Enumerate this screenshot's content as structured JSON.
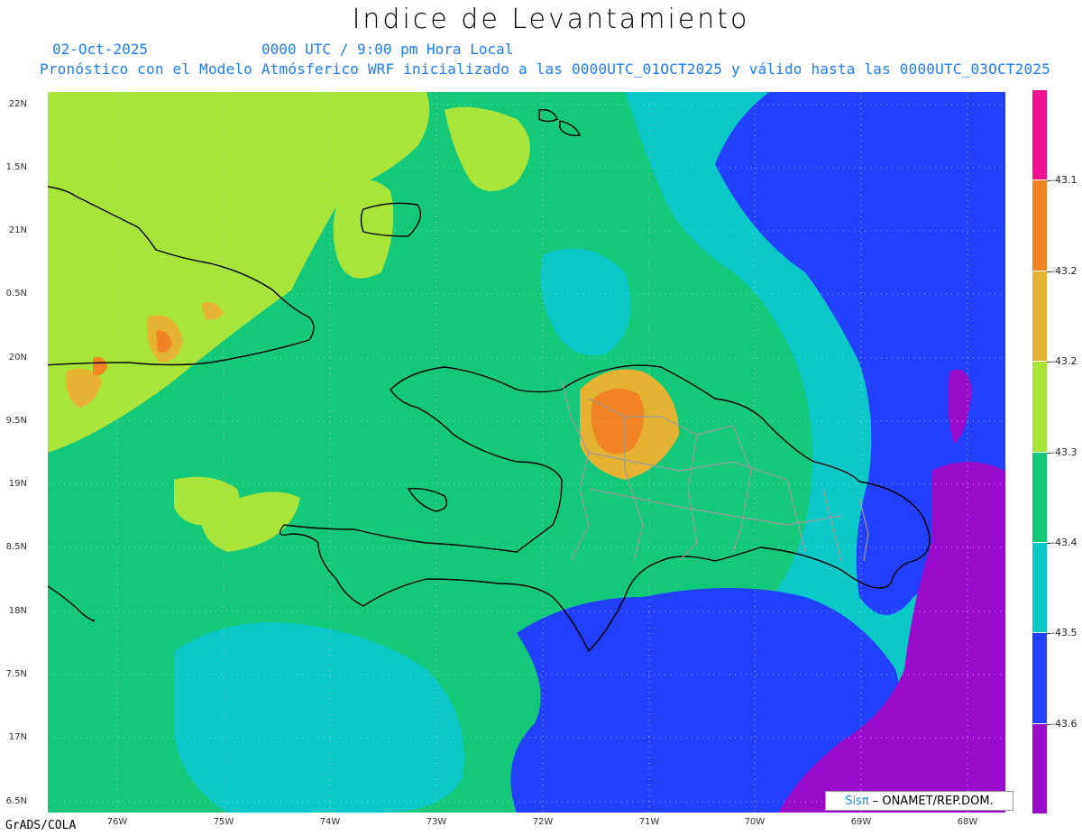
{
  "title": "Indice de Levantamiento",
  "date": "02-Oct-2025",
  "time": "0000 UTC / 9:00 pm Hora Local",
  "description": "Pronóstico con el Modelo Atmósferico WRF inicializado a las 0000UTC_01OCT2025 y válido hasta las  0000UTC_03OCT2025",
  "lat_labels": [
    "22N",
    "1.5N",
    "21N",
    "0.5N",
    "20N",
    "9.5N",
    "19N",
    "8.5N",
    "18N",
    "7.5N",
    "17N",
    "6.5N"
  ],
  "lon_labels": [
    "76W",
    "75W",
    "74W",
    "73W",
    "72W",
    "71W",
    "70W",
    "69W",
    "68W"
  ],
  "colorbar": {
    "labels": [
      "-43.1",
      "-43.2",
      "-43.2",
      "-43.3",
      "-43.4",
      "-43.5",
      "-43.6"
    ],
    "colors": [
      "#f0128f",
      "#f08426",
      "#e6b233",
      "#a8e43a",
      "#14c87a",
      "#0ac8c8",
      "#2141ff",
      "#9a0ccc"
    ]
  },
  "credit": {
    "brand": "Sisπ",
    "text": "– ONAMET/REP.DOM."
  },
  "footer": "GrADS/COLA"
}
